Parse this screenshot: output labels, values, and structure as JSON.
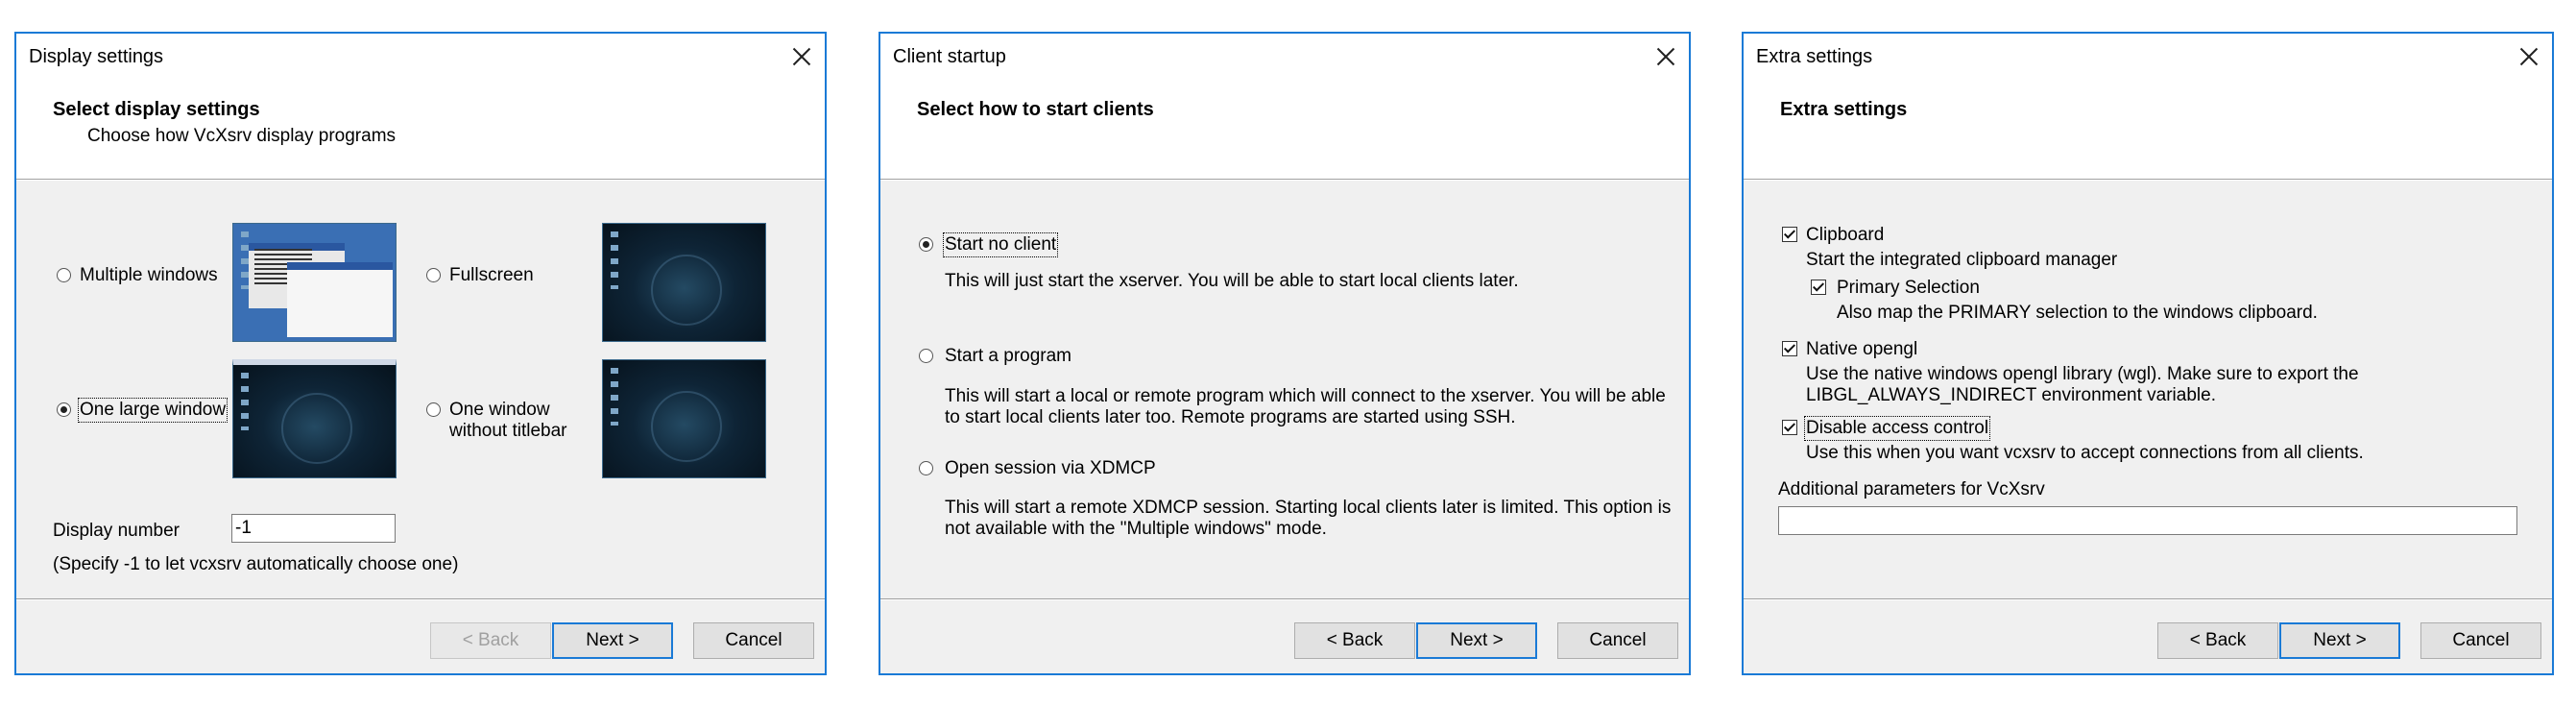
{
  "dialogs": [
    {
      "title": "Display settings",
      "header_title": "Select display settings",
      "header_sub": "Choose how VcXsrv display programs",
      "options": [
        {
          "label": "Multiple windows",
          "checked": false
        },
        {
          "label": "Fullscreen",
          "checked": false
        },
        {
          "label": "One large window",
          "checked": true
        },
        {
          "label_line1": "One window",
          "label_line2": "without titlebar",
          "checked": false
        }
      ],
      "display_number_label": "Display number",
      "display_number_value": "-1",
      "display_number_hint": "(Specify -1 to let vcxsrv automatically choose one)",
      "buttons": {
        "back": "< Back",
        "next": "Next >",
        "cancel": "Cancel"
      }
    },
    {
      "title": "Client startup",
      "header_title": "Select how to start clients",
      "options": [
        {
          "label": "Start no client",
          "checked": true,
          "desc": [
            "This will just start the xserver. You will be able to start local clients later."
          ]
        },
        {
          "label": "Start a program",
          "checked": false,
          "desc": [
            "This will start a local or remote program which will connect to the xserver. You will be able",
            "to start local clients later too. Remote programs are started using SSH."
          ]
        },
        {
          "label": "Open session via XDMCP",
          "checked": false,
          "desc": [
            "This will start a remote XDMCP session. Starting local clients later is limited. This option is",
            "not available with the \"Multiple windows\" mode."
          ]
        }
      ],
      "buttons": {
        "back": "< Back",
        "next": "Next >",
        "cancel": "Cancel"
      }
    },
    {
      "title": "Extra settings",
      "header_title": "Extra settings",
      "options": [
        {
          "label": "Clipboard",
          "checked": true,
          "desc": [
            "Start the integrated clipboard manager"
          ]
        },
        {
          "label": "Primary Selection",
          "checked": true,
          "desc": [
            "Also map the PRIMARY selection to the windows clipboard."
          ]
        },
        {
          "label": "Native opengl",
          "checked": true,
          "desc": [
            "Use the native windows opengl library (wgl). Make sure to export the",
            "LIBGL_ALWAYS_INDIRECT environment variable."
          ]
        },
        {
          "label": "Disable access control",
          "checked": true,
          "desc": [
            "Use this when you want vcxsrv to accept connections from all clients."
          ]
        }
      ],
      "additional_label": "Additional parameters for VcXsrv",
      "additional_value": "",
      "buttons": {
        "back": "< Back",
        "next": "Next >",
        "cancel": "Cancel"
      }
    }
  ]
}
